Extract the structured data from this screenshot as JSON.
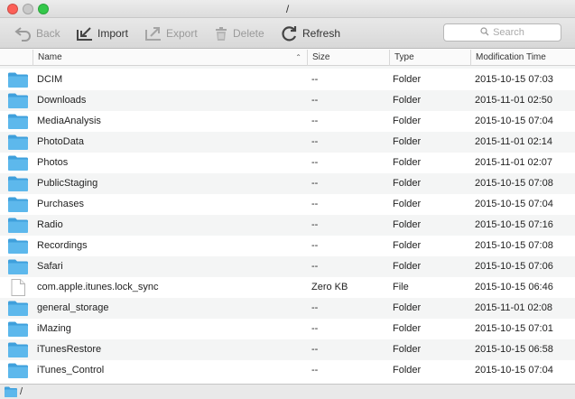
{
  "window": {
    "title": "/"
  },
  "toolbar": {
    "back_label": "Back",
    "import_label": "Import",
    "export_label": "Export",
    "delete_label": "Delete",
    "refresh_label": "Refresh",
    "search_placeholder": "Search"
  },
  "columns": {
    "name": "Name",
    "size": "Size",
    "type": "Type",
    "modified": "Modification Time"
  },
  "rows": [
    {
      "name": "DCIM",
      "size": "--",
      "type": "Folder",
      "modified": "2015-10-15 07:03",
      "icon": "folder-icon"
    },
    {
      "name": "Downloads",
      "size": "--",
      "type": "Folder",
      "modified": "2015-11-01 02:50",
      "icon": "folder-icon"
    },
    {
      "name": "MediaAnalysis",
      "size": "--",
      "type": "Folder",
      "modified": "2015-10-15 07:04",
      "icon": "folder-icon"
    },
    {
      "name": "PhotoData",
      "size": "--",
      "type": "Folder",
      "modified": "2015-11-01 02:14",
      "icon": "folder-icon"
    },
    {
      "name": "Photos",
      "size": "--",
      "type": "Folder",
      "modified": "2015-11-01 02:07",
      "icon": "folder-icon"
    },
    {
      "name": "PublicStaging",
      "size": "--",
      "type": "Folder",
      "modified": "2015-10-15 07:08",
      "icon": "folder-icon"
    },
    {
      "name": "Purchases",
      "size": "--",
      "type": "Folder",
      "modified": "2015-10-15 07:04",
      "icon": "folder-icon"
    },
    {
      "name": "Radio",
      "size": "--",
      "type": "Folder",
      "modified": "2015-10-15 07:16",
      "icon": "folder-icon"
    },
    {
      "name": "Recordings",
      "size": "--",
      "type": "Folder",
      "modified": "2015-10-15 07:08",
      "icon": "folder-icon"
    },
    {
      "name": "Safari",
      "size": "--",
      "type": "Folder",
      "modified": "2015-10-15 07:06",
      "icon": "folder-icon"
    },
    {
      "name": "com.apple.itunes.lock_sync",
      "size": "Zero KB",
      "type": "File",
      "modified": "2015-10-15 06:46",
      "icon": "file-icon"
    },
    {
      "name": "general_storage",
      "size": "--",
      "type": "Folder",
      "modified": "2015-11-01 02:08",
      "icon": "folder-icon"
    },
    {
      "name": "iMazing",
      "size": "--",
      "type": "Folder",
      "modified": "2015-10-15 07:01",
      "icon": "folder-icon"
    },
    {
      "name": "iTunesRestore",
      "size": "--",
      "type": "Folder",
      "modified": "2015-10-15 06:58",
      "icon": "folder-icon"
    },
    {
      "name": "iTunes_Control",
      "size": "--",
      "type": "Folder",
      "modified": "2015-10-15 07:04",
      "icon": "folder-icon"
    }
  ],
  "status": {
    "path": "/"
  },
  "colors": {
    "folder": "#5db8ec",
    "folder_dark": "#3fa0dc",
    "row_alt": "#f4f5f5"
  }
}
